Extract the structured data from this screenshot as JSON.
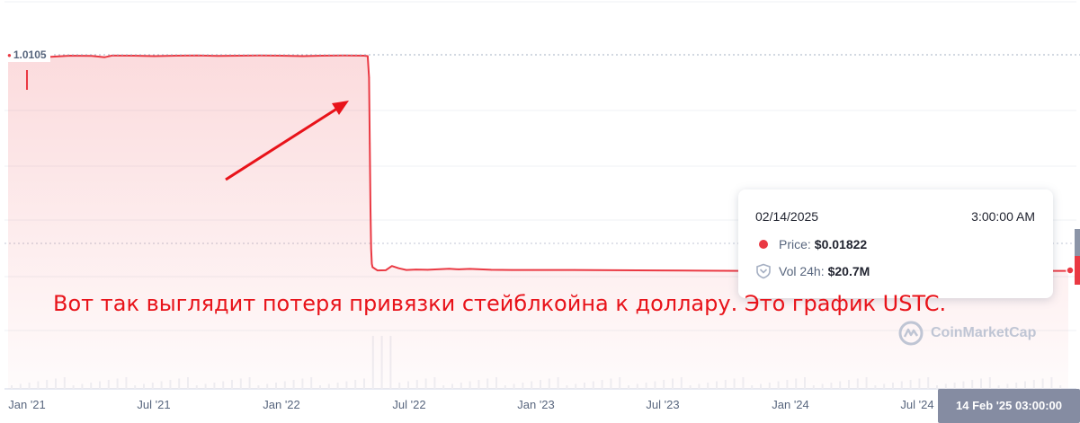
{
  "chart_data": {
    "type": "area",
    "title": "",
    "xlabel": "",
    "ylabel": "",
    "x_tick_labels": [
      "Jan '21",
      "Jul '21",
      "Jan '22",
      "Jul '22",
      "Jan '23",
      "Jul '23",
      "Jan '24",
      "Jul '24"
    ],
    "current_price_label": "1.0105",
    "cursor_label": "14 Feb '25 03:00:00",
    "series": [
      {
        "x": [
          "2020-12-01",
          "2020-12-20",
          "2021-01-01",
          "2021-01-10",
          "2021-02-01",
          "2021-03-01",
          "2021-04-01",
          "2021-04-20",
          "2021-05-01",
          "2021-06-01",
          "2021-07-01",
          "2021-08-01",
          "2021-09-01",
          "2021-10-01",
          "2021-11-01",
          "2021-12-01",
          "2022-01-01",
          "2022-02-01",
          "2022-03-01",
          "2022-04-01",
          "2022-05-01",
          "2022-05-06",
          "2022-05-08",
          "2022-05-09",
          "2022-05-10",
          "2022-05-11",
          "2022-05-12",
          "2022-05-13",
          "2022-05-20",
          "2022-06-01",
          "2022-06-10",
          "2022-06-20",
          "2022-07-01",
          "2022-07-15",
          "2022-08-01",
          "2022-09-01",
          "2022-09-15",
          "2022-10-01",
          "2022-11-01",
          "2022-12-01",
          "2023-01-01",
          "2023-03-01",
          "2023-05-01",
          "2023-07-01",
          "2023-09-01",
          "2023-11-01",
          "2024-01-01",
          "2024-03-01",
          "2024-05-01",
          "2024-07-01",
          "2024-09-01",
          "2024-11-01",
          "2025-01-01",
          "2025-02-14"
        ],
        "y": [
          1.002,
          1.001,
          1.0,
          0.98,
          0.995,
          1.0,
          0.999,
          0.993,
          1.001,
          1.0,
          0.998,
          1.0,
          1.001,
          0.999,
          1.0,
          1.001,
          1.0,
          0.998,
          1.0,
          1.001,
          1.0,
          0.998,
          0.9,
          0.6,
          0.3,
          0.12,
          0.05,
          0.035,
          0.02,
          0.021,
          0.04,
          0.03,
          0.022,
          0.024,
          0.023,
          0.028,
          0.025,
          0.027,
          0.023,
          0.022,
          0.022,
          0.022,
          0.021,
          0.02,
          0.019,
          0.018,
          0.018,
          0.018,
          0.019,
          0.02,
          0.019,
          0.018,
          0.018,
          0.01822
        ]
      }
    ],
    "tooltip": {
      "date": "02/14/2025",
      "time": "3:00:00 AM",
      "price_label": "Price:",
      "price_value": "$0.01822",
      "volume_label": "Vol 24h:",
      "volume_value": "$20.7M"
    },
    "grid": true,
    "colors": {
      "line": "#ea3943",
      "fill": "#ea3943",
      "axis_text": "#58667e",
      "cursor_badge": "#858ca2"
    }
  },
  "watermark": "CoinMarketCap",
  "annotation": {
    "text": "Вот так выглядит потеря привязки стейблкойна к доллару. Это график USTC.",
    "color": "#e8131a"
  }
}
